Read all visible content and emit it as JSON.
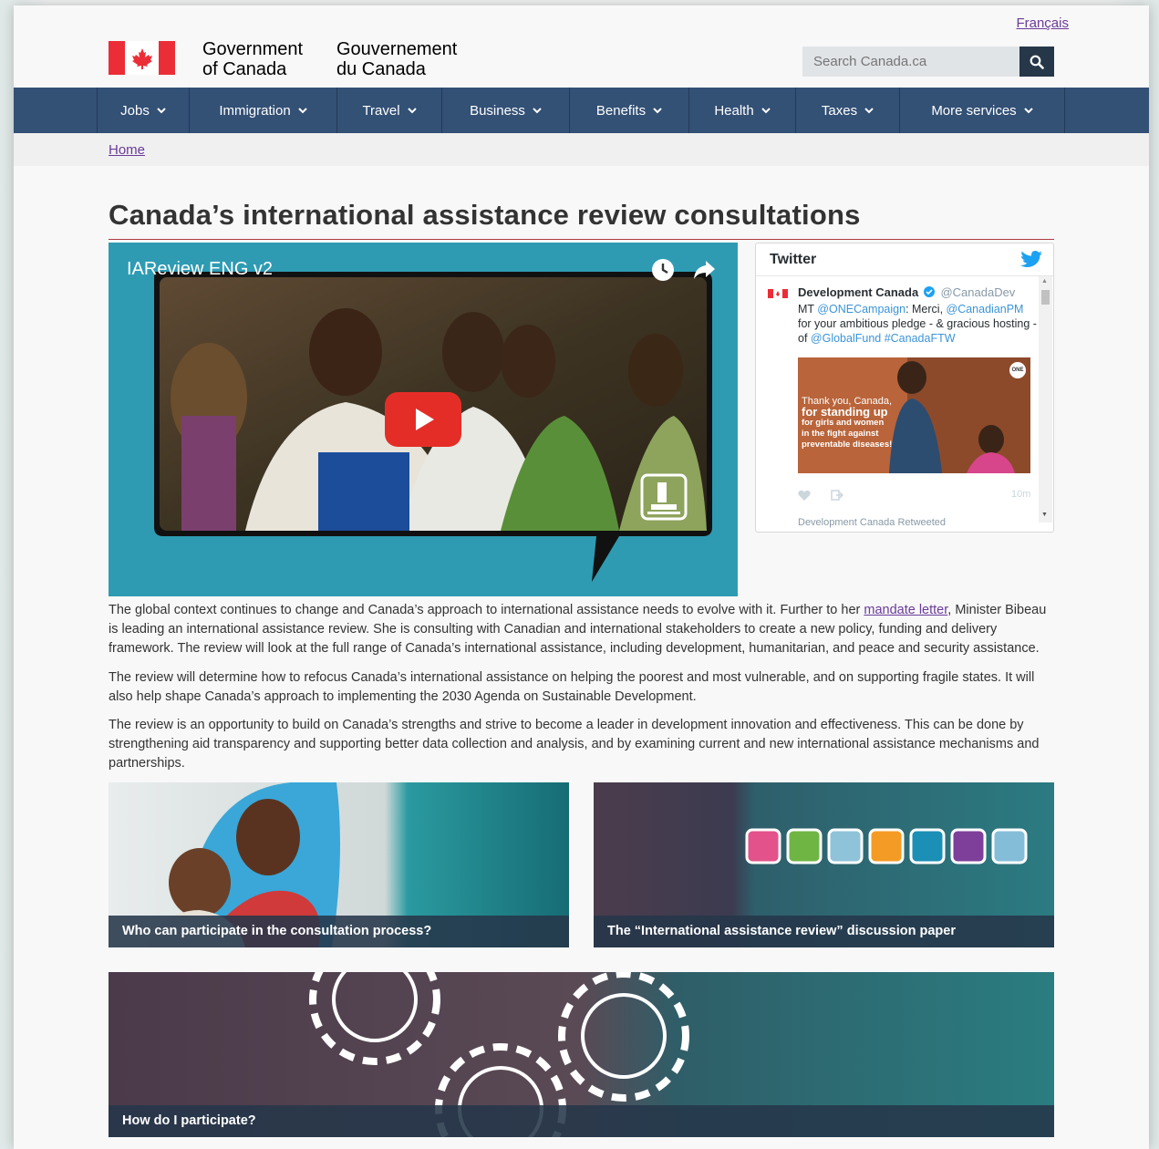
{
  "header": {
    "language_link": "Français",
    "signature_en_line1": "Government",
    "signature_en_line2": "of Canada",
    "signature_fr_line1": "Gouvernement",
    "signature_fr_line2": "du Canada",
    "search_placeholder": "Search Canada.ca",
    "search_icon": "search-icon"
  },
  "nav": {
    "items": [
      {
        "label": "Jobs"
      },
      {
        "label": "Immigration"
      },
      {
        "label": "Travel"
      },
      {
        "label": "Business"
      },
      {
        "label": "Benefits"
      },
      {
        "label": "Health"
      },
      {
        "label": "Taxes"
      },
      {
        "label": "More services"
      }
    ],
    "bg_color": "#335075"
  },
  "breadcrumb": {
    "home": "Home"
  },
  "page": {
    "title": "Canada’s international assistance review consultations"
  },
  "video": {
    "title": "IAReview ENG v2",
    "icons": [
      "clock-icon",
      "share-icon",
      "play-icon",
      "gavel-icon"
    ]
  },
  "twitter": {
    "title": "Twitter",
    "tweet": {
      "author": "Development Canada",
      "handle": "@CanadaDev",
      "text_mt": "MT ",
      "mention1": "@ONECampaign",
      "text_mid": ": Merci, ",
      "mention2": "@CanadianPM",
      "text_rest": " for your ambitious pledge - & gracious hosting - of ",
      "mention3": "@GlobalFund",
      "hashtag": " #CanadaFTW",
      "image_line1": "Thank you, Canada,",
      "image_line2": "for standing up",
      "image_line3": "for girls and women",
      "image_line4": "in the fight against",
      "image_line5": "preventable diseases!",
      "image_badge": "ONE",
      "time": "10m"
    },
    "next_tweet": "Development Canada Retweeted"
  },
  "body": {
    "p1_before": "The global context continues to change and Canada’s approach to international assistance needs to evolve with it. Further to her ",
    "p1_link": "mandate letter",
    "p1_after": ", Minister Bibeau is leading an international assistance review. She is consulting with Canadian and international stakeholders to create a new policy, funding and delivery framework. The review will look at the full range of Canada’s international assistance, including development, humanitarian, and peace and security assistance.",
    "p2": "The review will determine how to refocus Canada’s international assistance on helping the poorest and most vulnerable, and on supporting fragile states. It will also help shape Canada’s approach to implementing the 2030 Agenda on Sustainable Development.",
    "p3": "The review is an opportunity to build on Canada’s strengths and strive to become a leader in development innovation and effectiveness. This can be done by strengthening aid transparency and supporting better data collection and analysis, and by examining current and new international assistance mechanisms and partnerships."
  },
  "cards": [
    {
      "caption": "Who can participate in the consultation process?"
    },
    {
      "caption": "The “International assistance review” discussion paper"
    },
    {
      "caption": "How do I participate?"
    }
  ]
}
